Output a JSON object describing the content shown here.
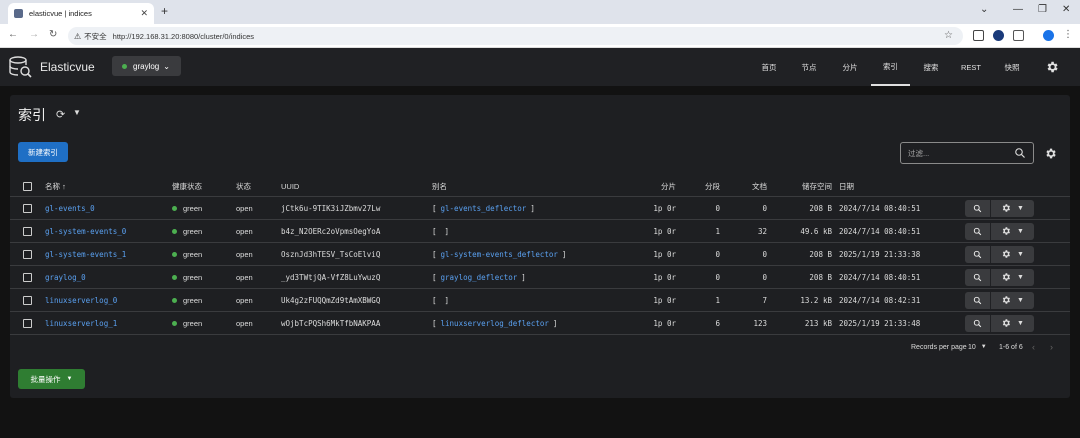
{
  "browser": {
    "tab_title": "elasticvue | indices",
    "new_tab": "+",
    "url_warning": "不安全",
    "url": "http://192.168.31.20:8080/cluster/0/indices"
  },
  "app": {
    "name": "Elasticvue",
    "cluster": "graylog",
    "nav": [
      "首页",
      "节点",
      "分片",
      "索引",
      "搜索",
      "REST",
      "快照"
    ],
    "active_nav": "索引"
  },
  "page": {
    "title": "索引",
    "new_index_label": "新建索引",
    "filter_placeholder": "过滤...",
    "bulk_label": "批量操作"
  },
  "table": {
    "headers": {
      "name": "名称 ↑",
      "health": "健康状态",
      "status": "状态",
      "uuid": "UUID",
      "alias": "别名",
      "shards": "分片",
      "segments": "分段",
      "docs": "文档",
      "storage": "储存空间",
      "date": "日期"
    },
    "rows": [
      {
        "name": "gl-events_0",
        "health": "green",
        "status": "open",
        "uuid": "jCtk6u-9TIK3iJZbmv27Lw",
        "alias_l": "[",
        "alias": "gl-events_deflector",
        "alias_r": "]",
        "shards": "1p  0r",
        "segments": "0",
        "docs": "0",
        "size": "208 B",
        "date": "2024/7/14 08:40:51"
      },
      {
        "name": "gl-system-events_0",
        "health": "green",
        "status": "open",
        "uuid": "b4z_N2OERc2oVpmsOegYoA",
        "alias_l": "[",
        "alias": "",
        "alias_r": "]",
        "shards": "1p  0r",
        "segments": "1",
        "docs": "32",
        "size": "49.6 kB",
        "date": "2024/7/14 08:40:51"
      },
      {
        "name": "gl-system-events_1",
        "health": "green",
        "status": "open",
        "uuid": "OsznJd3hTESV_TsCoElviQ",
        "alias_l": "[",
        "alias": "gl-system-events_deflector",
        "alias_r": "]",
        "shards": "1p  0r",
        "segments": "0",
        "docs": "0",
        "size": "208 B",
        "date": "2025/1/19 21:33:38"
      },
      {
        "name": "graylog_0",
        "health": "green",
        "status": "open",
        "uuid": "_yd3TWtjQA-VfZ8LuYwuzQ",
        "alias_l": "[",
        "alias": "graylog_deflector",
        "alias_r": "]",
        "shards": "1p  0r",
        "segments": "0",
        "docs": "0",
        "size": "208 B",
        "date": "2024/7/14 08:40:51"
      },
      {
        "name": "linuxserverlog_0",
        "health": "green",
        "status": "open",
        "uuid": "Uk4g2zFUQQmZd9tAmXBWGQ",
        "alias_l": "[",
        "alias": "",
        "alias_r": "]",
        "shards": "1p  0r",
        "segments": "1",
        "docs": "7",
        "size": "13.2 kB",
        "date": "2024/7/14 08:42:31"
      },
      {
        "name": "linuxserverlog_1",
        "health": "green",
        "status": "open",
        "uuid": "wOjbTcPQSh6MkTfbNAKPAA",
        "alias_l": "[",
        "alias": "linuxserverlog_deflector",
        "alias_r": "]",
        "shards": "1p  0r",
        "segments": "6",
        "docs": "123",
        "size": "213 kB",
        "date": "2025/1/19 21:33:48"
      }
    ]
  },
  "pagination": {
    "label": "Records per page",
    "per_page": "10",
    "range": "1-6 of 6"
  },
  "colors": {
    "primary": "#1f6fc5",
    "success": "#2f7d32",
    "link": "#5aa0f0",
    "health_green": "#4caf50"
  }
}
